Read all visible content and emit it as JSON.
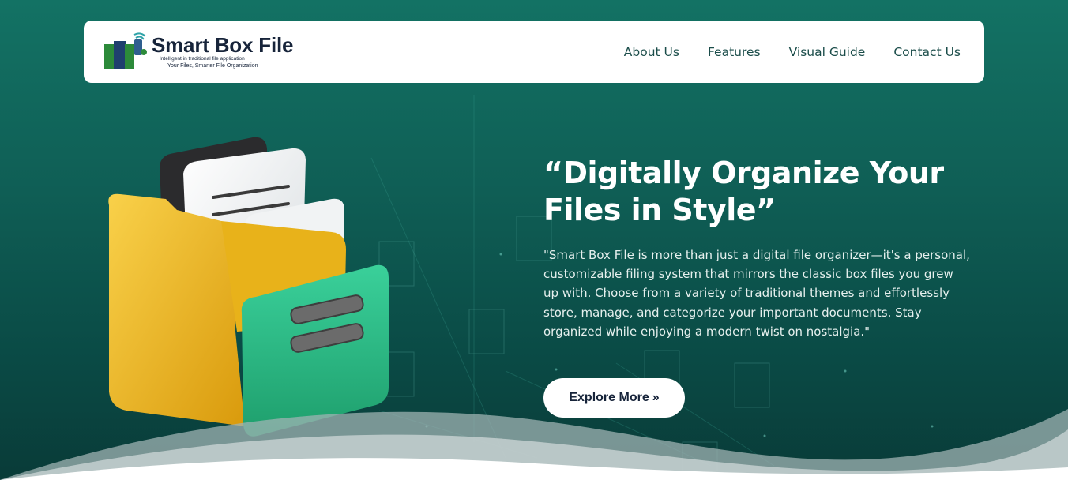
{
  "brand": {
    "name": "Smart Box File",
    "tagline_1": "Intelligent in traditional file application",
    "tagline_2": "Your Files, Smarter File Organization"
  },
  "nav": {
    "items": [
      {
        "label": "About Us"
      },
      {
        "label": "Features"
      },
      {
        "label": "Visual Guide"
      },
      {
        "label": "Contact Us"
      }
    ]
  },
  "hero": {
    "title": "“Digitally Organize Your Files in Style”",
    "description": "\"Smart Box File is more than just a digital file organizer—it's a personal, customizable filing system that mirrors the classic box files you grew up with. Choose from a variety of traditional themes and effortlessly store, manage, and categorize your important documents. Stay organized while enjoying a modern twist on nostalgia.\"",
    "cta_label": "Explore More",
    "cta_icon": "»"
  },
  "colors": {
    "background_top": "#137264",
    "background_bottom": "#093b38",
    "nav_text": "#1b4d4a",
    "brand_text": "#17243a",
    "folder_yellow": "#f2bb1f",
    "folder_green": "#2fbf86"
  }
}
